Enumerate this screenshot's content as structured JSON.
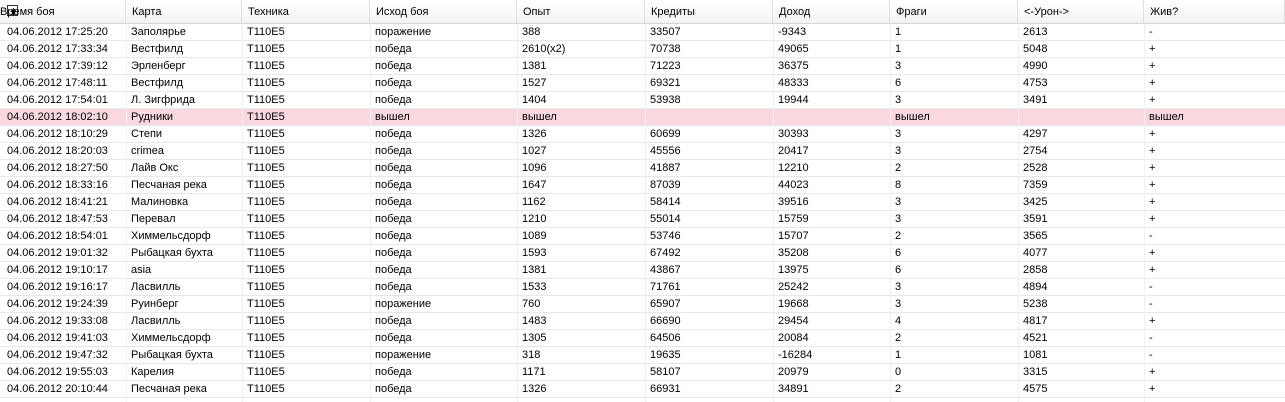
{
  "columns": [
    "Время боя",
    "Карта",
    "Техника",
    "Исход боя",
    "Опыт",
    "Кредиты",
    "Доход",
    "Фраги",
    "<-Урон->",
    "Жив?"
  ],
  "rows": [
    [
      "04.06.2012 17:25:20",
      "Заполярье",
      "T110E5",
      "поражение",
      "388",
      "33507",
      "-9343",
      "1",
      "2613",
      "-"
    ],
    [
      "04.06.2012 17:33:34",
      "Вестфилд",
      "T110E5",
      "победа",
      "2610(x2)",
      "70738",
      "49065",
      "1",
      "5048",
      "+"
    ],
    [
      "04.06.2012 17:39:12",
      "Эрленберг",
      "T110E5",
      "победа",
      "1381",
      "71223",
      "36375",
      "3",
      "4990",
      "+"
    ],
    [
      "04.06.2012 17:48:11",
      "Вестфилд",
      "T110E5",
      "победа",
      "1527",
      "69321",
      "48333",
      "6",
      "4753",
      "+"
    ],
    [
      "04.06.2012 17:54:01",
      "Л. Зигфрида",
      "T110E5",
      "победа",
      "1404",
      "53938",
      "19944",
      "3",
      "3491",
      "+"
    ],
    [
      "04.06.2012 18:02:10",
      "Рудники",
      "T110E5",
      "вышел",
      "вышел",
      "",
      "",
      "вышел",
      "",
      "вышел"
    ],
    [
      "04.06.2012 18:10:29",
      "Степи",
      "T110E5",
      "победа",
      "1326",
      "60699",
      "30393",
      "3",
      "4297",
      "+"
    ],
    [
      "04.06.2012 18:20:03",
      "crimea",
      "T110E5",
      "победа",
      "1027",
      "45556",
      "20417",
      "3",
      "2754",
      "+"
    ],
    [
      "04.06.2012 18:27:50",
      "Лайв Окс",
      "T110E5",
      "победа",
      "1096",
      "41887",
      "12210",
      "2",
      "2528",
      "+"
    ],
    [
      "04.06.2012 18:33:16",
      "Песчаная река",
      "T110E5",
      "победа",
      "1647",
      "87039",
      "44023",
      "8",
      "7359",
      "+"
    ],
    [
      "04.06.2012 18:41:21",
      "Малиновка",
      "T110E5",
      "победа",
      "1162",
      "58414",
      "39516",
      "3",
      "3425",
      "+"
    ],
    [
      "04.06.2012 18:47:53",
      "Перевал",
      "T110E5",
      "победа",
      "1210",
      "55014",
      "15759",
      "3",
      "3591",
      "+"
    ],
    [
      "04.06.2012 18:54:01",
      "Химмельсдорф",
      "T110E5",
      "победа",
      "1089",
      "53746",
      "15707",
      "2",
      "3565",
      "-"
    ],
    [
      "04.06.2012 19:01:32",
      "Рыбацкая бухта",
      "T110E5",
      "победа",
      "1593",
      "67492",
      "35208",
      "6",
      "4077",
      "+"
    ],
    [
      "04.06.2012 19:10:17",
      "asia",
      "T110E5",
      "победа",
      "1381",
      "43867",
      "13975",
      "6",
      "2858",
      "+"
    ],
    [
      "04.06.2012 19:16:17",
      "Ласвилль",
      "T110E5",
      "победа",
      "1533",
      "71761",
      "25242",
      "3",
      "4894",
      "-"
    ],
    [
      "04.06.2012 19:24:39",
      "Руинберг",
      "T110E5",
      "поражение",
      "760",
      "65907",
      "19668",
      "3",
      "5238",
      "-"
    ],
    [
      "04.06.2012 19:33:08",
      "Ласвилль",
      "T110E5",
      "победа",
      "1483",
      "66690",
      "29454",
      "4",
      "4817",
      "+"
    ],
    [
      "04.06.2012 19:41:03",
      "Химмельсдорф",
      "T110E5",
      "победа",
      "1305",
      "64506",
      "20084",
      "2",
      "4521",
      "-"
    ],
    [
      "04.06.2012 19:47:32",
      "Рыбацкая бухта",
      "T110E5",
      "поражение",
      "318",
      "19635",
      "-16284",
      "1",
      "1081",
      "-"
    ],
    [
      "04.06.2012 19:55:03",
      "Карелия",
      "T110E5",
      "победа",
      "1171",
      "58107",
      "20979",
      "0",
      "3315",
      "+"
    ],
    [
      "04.06.2012 20:10:44",
      "Песчаная река",
      "T110E5",
      "победа",
      "1326",
      "66931",
      "34891",
      "2",
      "4575",
      "+"
    ]
  ],
  "highlight_color": "#f9d9df",
  "highlight_row": 5,
  "sort_icon": "sort-up-arrow-icon"
}
